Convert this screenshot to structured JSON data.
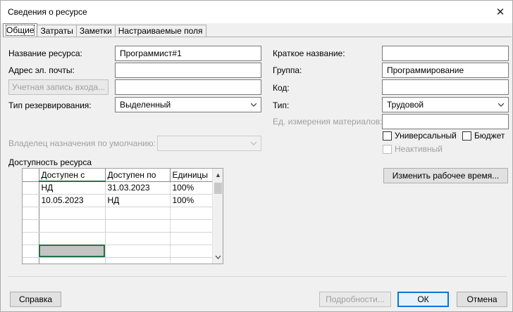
{
  "window": {
    "title": "Сведения о ресурсе",
    "close_glyph": "✕"
  },
  "tabs": [
    {
      "label": "Общие",
      "active": true
    },
    {
      "label": "Затраты",
      "active": false
    },
    {
      "label": "Заметки",
      "active": false
    },
    {
      "label": "Настраиваемые поля",
      "active": false
    }
  ],
  "general": {
    "name_label": "Название ресурса:",
    "name_value": "Программист#1",
    "email_label": "Адрес эл. почты:",
    "email_value": "",
    "account_button": "Учетная запись входа...",
    "account_value": "",
    "booking_label": "Тип резервирования:",
    "booking_value": "Выделенный",
    "short_name_label": "Краткое название:",
    "short_name_value": "",
    "group_label": "Группа:",
    "group_value": "Программирование",
    "code_label": "Код:",
    "code_value": "",
    "type_label": "Тип:",
    "type_value": "Трудовой",
    "material_label": "Ед. измерения материалов:",
    "material_value": "",
    "generic_label": "Универсальный",
    "generic_checked": false,
    "budget_label": "Бюджет",
    "budget_checked": false,
    "inactive_label": "Неактивный",
    "inactive_checked": false,
    "owner_label": "Владелец назначения по умолчанию:",
    "owner_value": "",
    "change_time_button": "Изменить рабочее время..."
  },
  "availability": {
    "title": "Доступность ресурса",
    "columns": [
      "Доступен с",
      "Доступен по",
      "Единицы"
    ],
    "rows": [
      [
        "НД",
        "31.03.2023",
        "100%"
      ],
      [
        "10.05.2023",
        "НД",
        "100%"
      ],
      [
        "",
        "",
        ""
      ],
      [
        "",
        "",
        ""
      ],
      [
        "",
        "",
        ""
      ],
      [
        "",
        "",
        ""
      ],
      [
        "",
        "",
        ""
      ]
    ]
  },
  "footer": {
    "help_button": "Справка",
    "details_button": "Подробности...",
    "ok_button": "ОК",
    "cancel_button": "Отмена"
  },
  "colors": {
    "accent": "#0078d7",
    "grid_selection": "#217346"
  }
}
